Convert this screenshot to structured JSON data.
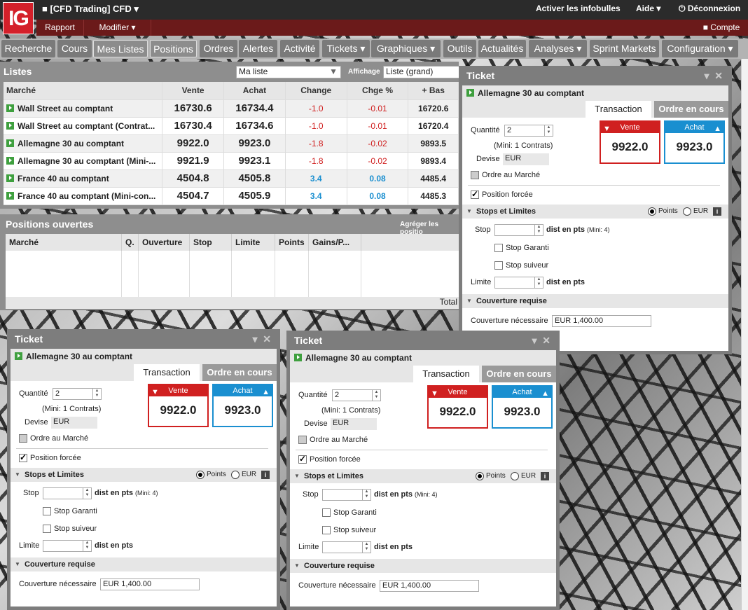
{
  "logo": "IG",
  "account": "[CFD Trading] CFD ▾",
  "top_links": {
    "infobulles": "Activer les infobulles",
    "aide": "Aide ▾",
    "deconnexion": "Déconnexion"
  },
  "bar2": {
    "rapport": "Rapport",
    "modifier": "Modifier ▾",
    "compte": "Compte"
  },
  "nav": [
    "Recherche",
    "Cours",
    "Mes Listes",
    "Positions",
    "Ordres",
    "Alertes",
    "Activité",
    "Tickets ▾",
    "Graphiques ▾",
    "Outils",
    "Actualités",
    "Analyses ▾",
    "Sprint Markets",
    "Configuration ▾"
  ],
  "listes": {
    "title": "Listes",
    "select": "Ma liste",
    "affichage_label": "Affichage",
    "affichage_value": "Liste (grand)",
    "headers": [
      "Marché",
      "Vente",
      "Achat",
      "Change",
      "Chge %",
      "+ Bas"
    ],
    "rows": [
      {
        "m": "Wall Street au comptant",
        "v": "16730.6",
        "a": "16734.4",
        "c": "-1.0",
        "p": "-0.01",
        "b": "16720.6",
        "neg": true
      },
      {
        "m": "Wall Street au comptant (Contrat...",
        "v": "16730.4",
        "a": "16734.6",
        "c": "-1.0",
        "p": "-0.01",
        "b": "16720.4",
        "neg": true
      },
      {
        "m": "Allemagne 30 au comptant",
        "v": "9922.0",
        "a": "9923.0",
        "c": "-1.8",
        "p": "-0.02",
        "b": "9893.5",
        "neg": true
      },
      {
        "m": "Allemagne 30 au comptant (Mini-...",
        "v": "9921.9",
        "a": "9923.1",
        "c": "-1.8",
        "p": "-0.02",
        "b": "9893.4",
        "neg": true
      },
      {
        "m": "France 40 au comptant",
        "v": "4504.8",
        "a": "4505.8",
        "c": "3.4",
        "p": "0.08",
        "b": "4485.4",
        "neg": false
      },
      {
        "m": "France 40 au comptant (Mini-con...",
        "v": "4504.7",
        "a": "4505.9",
        "c": "3.4",
        "p": "0.08",
        "b": "4485.3",
        "neg": false
      }
    ]
  },
  "positions": {
    "title": "Positions ouvertes",
    "agreger": "Agréger les positio",
    "headers": [
      "Marché",
      "Q.",
      "Ouverture",
      "Stop",
      "Limite",
      "Points",
      "Gains/P..."
    ],
    "total": "Total"
  },
  "ticket": {
    "title": "Ticket",
    "market": "Allemagne 30 au comptant",
    "tab_transaction": "Transaction",
    "tab_ordre": "Ordre en cours",
    "quantite_label": "Quantité",
    "quantite": "2",
    "mini": "(Mini: 1 Contrats)",
    "devise_label": "Devise",
    "devise": "EUR",
    "vente_label": "Vente",
    "vente": "9922.0",
    "achat_label": "Achat",
    "achat": "9923.0",
    "ordre_marche": "Ordre au Marché",
    "position_forcee": "Position forcée",
    "stops_title": "Stops et Limites",
    "points": "Points",
    "eur": "EUR",
    "stop_label": "Stop",
    "dist": "dist en pts",
    "mini_stop": "(Mini: 4)",
    "stop_garanti": "Stop Garanti",
    "stop_suiveur": "Stop suiveur",
    "limite_label": "Limite",
    "couverture_title": "Couverture requise",
    "couverture_label": "Couverture nécessaire",
    "couverture": "EUR 1,400.00"
  }
}
